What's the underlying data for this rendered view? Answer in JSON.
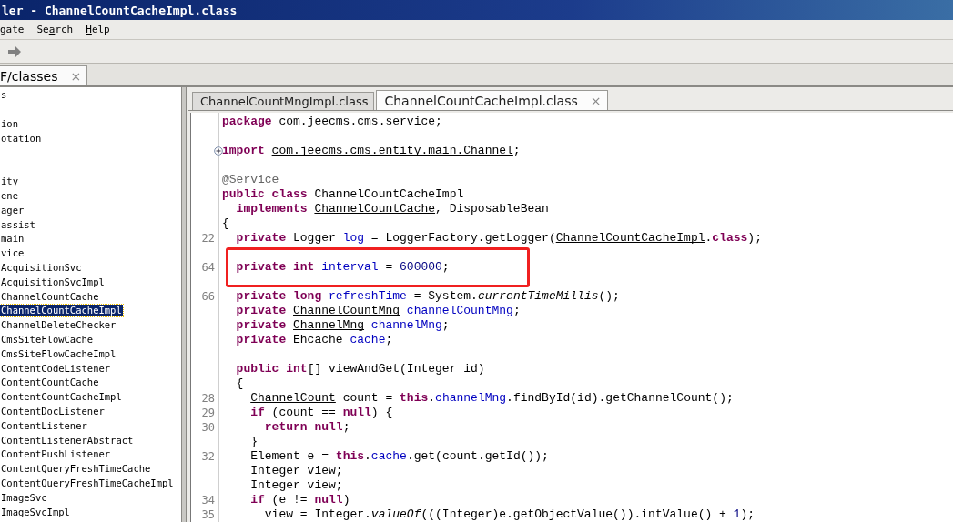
{
  "window": {
    "title": "ler - ChannelCountCacheImpl.class"
  },
  "menu": [
    {
      "parts": [
        {
          "text": "gate",
          "underlined": false
        }
      ]
    },
    {
      "parts": [
        {
          "text": "Se",
          "underlined": false
        },
        {
          "text": "a",
          "underlined": true
        },
        {
          "text": "rch",
          "underlined": false
        }
      ]
    },
    {
      "parts": [
        {
          "text": "H",
          "underlined": true
        },
        {
          "text": "elp",
          "underlined": false
        }
      ]
    }
  ],
  "file_tab": {
    "label": "F/classes",
    "close": "×"
  },
  "tree": [
    {
      "kind": "row",
      "label": "s",
      "selected": false
    },
    {
      "kind": "blank"
    },
    {
      "kind": "row",
      "label": "ion",
      "selected": false
    },
    {
      "kind": "row",
      "label": "otation",
      "selected": false
    },
    {
      "kind": "blank"
    },
    {
      "kind": "blank"
    },
    {
      "kind": "row",
      "label": "ity",
      "selected": false
    },
    {
      "kind": "row",
      "label": "ene",
      "selected": false
    },
    {
      "kind": "row",
      "label": "ager",
      "selected": false
    },
    {
      "kind": "row",
      "label": "assist",
      "selected": false
    },
    {
      "kind": "row",
      "label": "main",
      "selected": false
    },
    {
      "kind": "row",
      "label": "vice",
      "selected": false
    },
    {
      "kind": "row",
      "label": "AcquisitionSvc",
      "selected": false
    },
    {
      "kind": "row",
      "label": "AcquisitionSvcImpl",
      "selected": false
    },
    {
      "kind": "row",
      "label": "ChannelCountCache",
      "selected": false
    },
    {
      "kind": "row",
      "label": "ChannelCountCacheImpl",
      "selected": true
    },
    {
      "kind": "row",
      "label": "ChannelDeleteChecker",
      "selected": false
    },
    {
      "kind": "row",
      "label": "CmsSiteFlowCache",
      "selected": false
    },
    {
      "kind": "row",
      "label": "CmsSiteFlowCacheImpl",
      "selected": false
    },
    {
      "kind": "row",
      "label": "ContentCodeListener",
      "selected": false
    },
    {
      "kind": "row",
      "label": "ContentCountCache",
      "selected": false
    },
    {
      "kind": "row",
      "label": "ContentCountCacheImpl",
      "selected": false
    },
    {
      "kind": "row",
      "label": "ContentDocListener",
      "selected": false
    },
    {
      "kind": "row",
      "label": "ContentListener",
      "selected": false
    },
    {
      "kind": "row",
      "label": "ContentListenerAbstract",
      "selected": false
    },
    {
      "kind": "row",
      "label": "ContentPushListener",
      "selected": false
    },
    {
      "kind": "row",
      "label": "ContentQueryFreshTimeCache",
      "selected": false
    },
    {
      "kind": "row",
      "label": "ContentQueryFreshTimeCacheImpl",
      "selected": false
    },
    {
      "kind": "row",
      "label": "ImageSvc",
      "selected": false
    },
    {
      "kind": "row",
      "label": "ImageSvcImpl",
      "selected": false
    }
  ],
  "editor_tabs": [
    {
      "label": "ChannelCountMngImpl.class",
      "selected": false
    },
    {
      "label": "ChannelCountCacheImpl.class",
      "selected": true,
      "close": "×"
    }
  ],
  "code": [
    {
      "kind": "code",
      "tokens": [
        {
          "kind": "keyword",
          "text": "package"
        },
        {
          "kind": "plain",
          "text": " com.jeecms.cms.service;"
        }
      ]
    },
    {
      "kind": "blank"
    },
    {
      "kind": "code",
      "fold_marker": {
        "collapsed": true
      },
      "tokens": [
        {
          "kind": "keyword",
          "text": "import "
        },
        {
          "kind": "type",
          "text": "com.jeecms.cms.entity.main.Channel"
        },
        {
          "kind": "plain",
          "text": ";"
        }
      ]
    },
    {
      "kind": "blank"
    },
    {
      "kind": "code",
      "tokens": [
        {
          "kind": "annotation",
          "text": "@Service"
        }
      ]
    },
    {
      "kind": "code",
      "tokens": [
        {
          "kind": "keyword",
          "text": "public class"
        },
        {
          "kind": "plain",
          "text": " ChannelCountCacheImpl"
        }
      ]
    },
    {
      "kind": "code",
      "tokens": [
        {
          "kind": "keyword",
          "text": "  implements "
        },
        {
          "kind": "type",
          "text": "ChannelCountCache"
        },
        {
          "kind": "plain",
          "text": ", DisposableBean"
        }
      ]
    },
    {
      "kind": "code",
      "tokens": [
        {
          "kind": "plain",
          "text": "{"
        }
      ]
    },
    {
      "kind": "code",
      "number": "22",
      "tokens": [
        {
          "kind": "keyword",
          "text": "  private"
        },
        {
          "kind": "plain",
          "text": " Logger "
        },
        {
          "kind": "field",
          "text": "log"
        },
        {
          "kind": "plain",
          "text": " = LoggerFactory.getLogger("
        },
        {
          "kind": "type",
          "text": "ChannelCountCacheImpl"
        },
        {
          "kind": "plain",
          "text": "."
        },
        {
          "kind": "keyword",
          "text": "class"
        },
        {
          "kind": "plain",
          "text": ");"
        }
      ]
    },
    {
      "kind": "blank"
    },
    {
      "kind": "code",
      "number": "64",
      "tokens": [
        {
          "kind": "keyword",
          "text": "  private int "
        },
        {
          "kind": "field",
          "text": "interval"
        },
        {
          "kind": "plain",
          "text": " = "
        },
        {
          "kind": "number",
          "text": "600000"
        },
        {
          "kind": "plain",
          "text": ";"
        }
      ]
    },
    {
      "kind": "blank"
    },
    {
      "kind": "code",
      "number": "66",
      "tokens": [
        {
          "kind": "keyword",
          "text": "  private long "
        },
        {
          "kind": "field",
          "text": "refreshTime"
        },
        {
          "kind": "plain",
          "text": " = System."
        },
        {
          "kind": "method",
          "text": "currentTimeMillis"
        },
        {
          "kind": "plain",
          "text": "();"
        }
      ]
    },
    {
      "kind": "code",
      "tokens": [
        {
          "kind": "keyword",
          "text": "  private "
        },
        {
          "kind": "type",
          "text": "ChannelCountMng"
        },
        {
          "kind": "field",
          "text": " channelCountMng"
        },
        {
          "kind": "plain",
          "text": ";"
        }
      ]
    },
    {
      "kind": "code",
      "tokens": [
        {
          "kind": "keyword",
          "text": "  private "
        },
        {
          "kind": "type",
          "text": "ChannelMng"
        },
        {
          "kind": "field",
          "text": " channelMng"
        },
        {
          "kind": "plain",
          "text": ";"
        }
      ]
    },
    {
      "kind": "code",
      "tokens": [
        {
          "kind": "keyword",
          "text": "  private"
        },
        {
          "kind": "plain",
          "text": " Ehcache "
        },
        {
          "kind": "field",
          "text": "cache"
        },
        {
          "kind": "plain",
          "text": ";"
        }
      ]
    },
    {
      "kind": "blank"
    },
    {
      "kind": "code",
      "tokens": [
        {
          "kind": "keyword",
          "text": "  public int"
        },
        {
          "kind": "plain",
          "text": "[] viewAndGet(Integer id)"
        }
      ]
    },
    {
      "kind": "code",
      "tokens": [
        {
          "kind": "plain",
          "text": "  {"
        }
      ]
    },
    {
      "kind": "code",
      "number": "28",
      "tokens": [
        {
          "kind": "type",
          "text": "    ChannelCount"
        },
        {
          "kind": "plain",
          "text": " count = "
        },
        {
          "kind": "keyword",
          "text": "this"
        },
        {
          "kind": "plain",
          "text": "."
        },
        {
          "kind": "field",
          "text": "channelMng"
        },
        {
          "kind": "plain",
          "text": ".findById(id).getChannelCount();"
        }
      ]
    },
    {
      "kind": "code",
      "number": "29",
      "tokens": [
        {
          "kind": "keyword",
          "text": "    if"
        },
        {
          "kind": "plain",
          "text": " (count == "
        },
        {
          "kind": "keyword",
          "text": "null"
        },
        {
          "kind": "plain",
          "text": ") {"
        }
      ]
    },
    {
      "kind": "code",
      "number": "30",
      "tokens": [
        {
          "kind": "keyword",
          "text": "      return null"
        },
        {
          "kind": "plain",
          "text": ";"
        }
      ]
    },
    {
      "kind": "code",
      "tokens": [
        {
          "kind": "plain",
          "text": "    }"
        }
      ]
    },
    {
      "kind": "code",
      "number": "32",
      "tokens": [
        {
          "kind": "plain",
          "text": "    Element e = "
        },
        {
          "kind": "keyword",
          "text": "this"
        },
        {
          "kind": "plain",
          "text": "."
        },
        {
          "kind": "field",
          "text": "cache"
        },
        {
          "kind": "plain",
          "text": ".get(count.getId());"
        }
      ]
    },
    {
      "kind": "code",
      "tokens": [
        {
          "kind": "plain",
          "text": "    Integer view;"
        }
      ]
    },
    {
      "kind": "code",
      "tokens": [
        {
          "kind": "plain",
          "text": "    Integer view;"
        }
      ]
    },
    {
      "kind": "code",
      "number": "34",
      "tokens": [
        {
          "kind": "keyword",
          "text": "    if"
        },
        {
          "kind": "plain",
          "text": " (e != "
        },
        {
          "kind": "keyword",
          "text": "null"
        },
        {
          "kind": "plain",
          "text": ")"
        }
      ]
    },
    {
      "kind": "code",
      "number": "35",
      "tokens": [
        {
          "kind": "plain",
          "text": "      view = Integer."
        },
        {
          "kind": "method",
          "text": "valueOf"
        },
        {
          "kind": "plain",
          "text": "(((Integer)e.getObjectValue()).intValue() + "
        },
        {
          "kind": "number",
          "text": "1"
        },
        {
          "kind": "plain",
          "text": ");"
        }
      ]
    }
  ]
}
